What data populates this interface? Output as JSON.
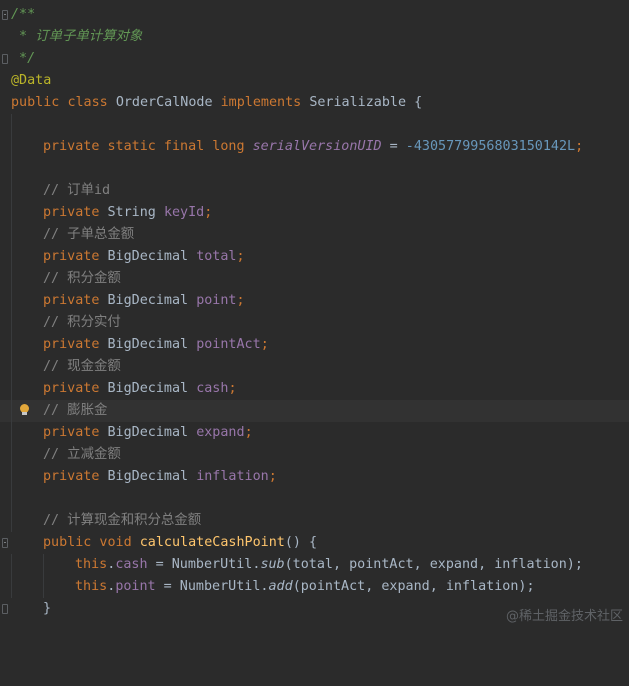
{
  "colors": {
    "background": "#2b2b2b",
    "keyword": "#cc7832",
    "field": "#9876aa",
    "number": "#6897bb",
    "comment": "#808080",
    "doc_comment": "#629755",
    "annotation": "#bbb529",
    "method": "#ffc66d",
    "text": "#a9b7c6"
  },
  "code": {
    "doc_open": "/**",
    "doc_line": " * 订单子单计算对象",
    "doc_close": " */",
    "annotation": "@Data",
    "class_decl": {
      "kw_public": "public",
      "kw_class": "class",
      "class_name": "OrderCalNode",
      "kw_implements": "implements",
      "interface": "Serializable",
      "brace": " {"
    },
    "serial": {
      "mods": "private static final long ",
      "name": "serialVersionUID",
      "eq": " = ",
      "value": "-4305779956803150142L",
      "semi": ";"
    },
    "fields": [
      {
        "comment": "// 订单id",
        "type": "String",
        "name": "keyId"
      },
      {
        "comment": "// 子单总金额",
        "type": "BigDecimal",
        "name": "total"
      },
      {
        "comment": "// 积分金额",
        "type": "BigDecimal",
        "name": "point"
      },
      {
        "comment": "// 积分实付",
        "type": "BigDecimal",
        "name": "pointAct"
      },
      {
        "comment": "// 现金金额",
        "type": "BigDecimal",
        "name": "cash"
      },
      {
        "comment": "// 膨胀金",
        "type": "BigDecimal",
        "name": "expand"
      },
      {
        "comment": "// 立减金额",
        "type": "BigDecimal",
        "name": "inflation"
      }
    ],
    "kw_private": "private",
    "semi": ";",
    "method": {
      "comment": "// 计算现金和积分总金额",
      "mods": "public void ",
      "name": "calculateCashPoint",
      "sig_rest": "() {",
      "line1": {
        "this": "this",
        "dot": ".",
        "field": "cash",
        "mid": " = NumberUtil.",
        "call": "sub",
        "args": "(total, pointAct, expand, inflation);"
      },
      "line2": {
        "this": "this",
        "dot": ".",
        "field": "point",
        "mid": " = NumberUtil.",
        "call": "add",
        "args": "(pointAct, expand, inflation);"
      },
      "close": "}"
    }
  },
  "watermark": "@稀土掘金技术社区"
}
